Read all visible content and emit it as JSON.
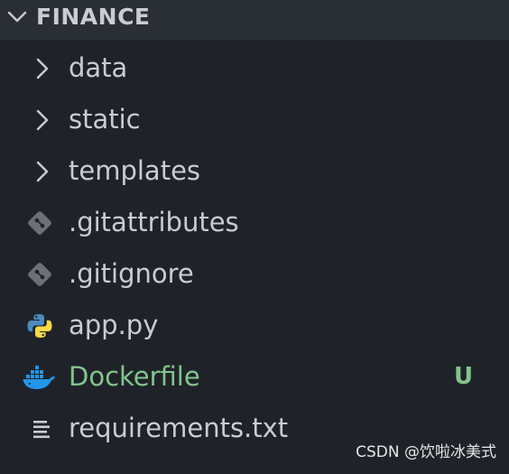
{
  "explorer": {
    "section_title": "FINANCE",
    "items": [
      {
        "label": "data",
        "kind": "folder",
        "icon": "chevron-right-icon"
      },
      {
        "label": "static",
        "kind": "folder",
        "icon": "chevron-right-icon"
      },
      {
        "label": "templates",
        "kind": "folder",
        "icon": "chevron-right-icon"
      },
      {
        "label": ".gitattributes",
        "kind": "file",
        "icon": "git-icon"
      },
      {
        "label": ".gitignore",
        "kind": "file",
        "icon": "git-icon"
      },
      {
        "label": "app.py",
        "kind": "file",
        "icon": "python-icon"
      },
      {
        "label": "Dockerfile",
        "kind": "file",
        "icon": "docker-icon",
        "status": "U",
        "status_color": "#84c48c"
      },
      {
        "label": "requirements.txt",
        "kind": "file",
        "icon": "text-lines-icon"
      }
    ]
  },
  "watermark": "CSDN @饮啦冰美式",
  "colors": {
    "background": "#1f2329",
    "header_background": "#2a2e35",
    "text": "#c9ccd1",
    "untracked": "#84c48c",
    "git_icon": "#6b7079",
    "python_blue": "#4b8bbe",
    "python_yellow": "#ffd845",
    "docker_blue": "#2496ed"
  }
}
